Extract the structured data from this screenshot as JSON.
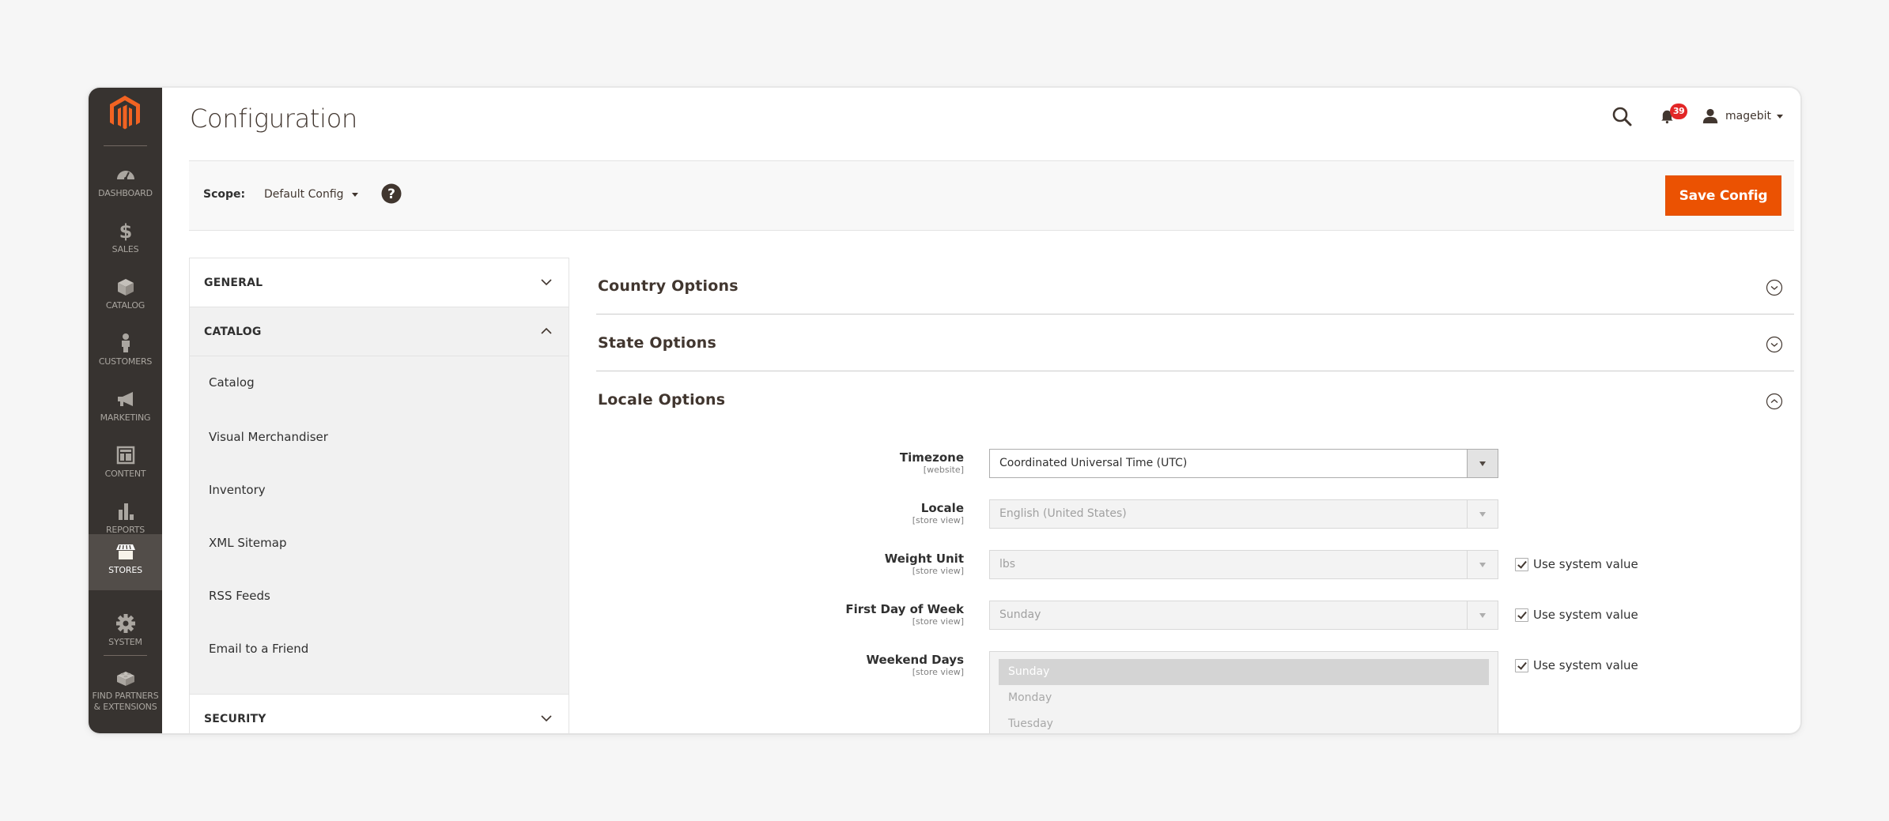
{
  "nav": {
    "items": [
      {
        "label": "Dashboard",
        "icon": "dashboard-icon"
      },
      {
        "label": "Sales",
        "icon": "dollar-icon"
      },
      {
        "label": "Catalog",
        "icon": "box-icon"
      },
      {
        "label": "Customers",
        "icon": "person-icon"
      },
      {
        "label": "Marketing",
        "icon": "megaphone-icon"
      },
      {
        "label": "Content",
        "icon": "layout-icon"
      },
      {
        "label": "Reports",
        "icon": "bar-chart-icon"
      },
      {
        "label": "Stores",
        "icon": "storefront-icon",
        "active": true
      },
      {
        "label": "System",
        "icon": "gear-icon"
      },
      {
        "label": "Find Partners & Extensions",
        "label_line1": "Find Partners",
        "label_line2": "& Extensions",
        "icon": "lego-brick-icon"
      }
    ]
  },
  "header": {
    "title": "Configuration",
    "notifications_count": "39",
    "username": "magebit"
  },
  "scope": {
    "label": "Scope:",
    "value": "Default Config",
    "save_label": "Save Config"
  },
  "config_menu": {
    "sections": [
      {
        "title": "GENERAL",
        "open": false
      },
      {
        "title": "CATALOG",
        "open": true,
        "items": [
          "Catalog",
          "Visual Merchandiser",
          "Inventory",
          "XML Sitemap",
          "RSS Feeds",
          "Email to a Friend"
        ]
      },
      {
        "title": "SECURITY",
        "open": false
      }
    ]
  },
  "panel": {
    "sections": [
      {
        "title": "Country Options",
        "expanded": false
      },
      {
        "title": "State Options",
        "expanded": false
      },
      {
        "title": "Locale Options",
        "expanded": true
      }
    ],
    "fields": [
      {
        "label": "Timezone",
        "scope": "[website]",
        "value": "Coordinated Universal Time (UTC)",
        "disabled": false
      },
      {
        "label": "Locale",
        "scope": "[store view]",
        "value": "English (United States)",
        "disabled": true
      },
      {
        "label": "Weight Unit",
        "scope": "[store view]",
        "value": "lbs",
        "disabled": true,
        "use_system": true
      },
      {
        "label": "First Day of Week",
        "scope": "[store view]",
        "value": "Sunday",
        "disabled": true,
        "use_system": true
      },
      {
        "label": "Weekend Days",
        "scope": "[store view]",
        "options": [
          "Sunday",
          "Monday",
          "Tuesday"
        ],
        "selected": "Sunday",
        "disabled": true,
        "use_system": true
      }
    ],
    "use_system_label": "Use system value"
  },
  "colors": {
    "accent": "#eb5202",
    "nav_bg": "#373330",
    "nav_active": "#524d49",
    "badge": "#e22626",
    "logo": "#f26322"
  }
}
